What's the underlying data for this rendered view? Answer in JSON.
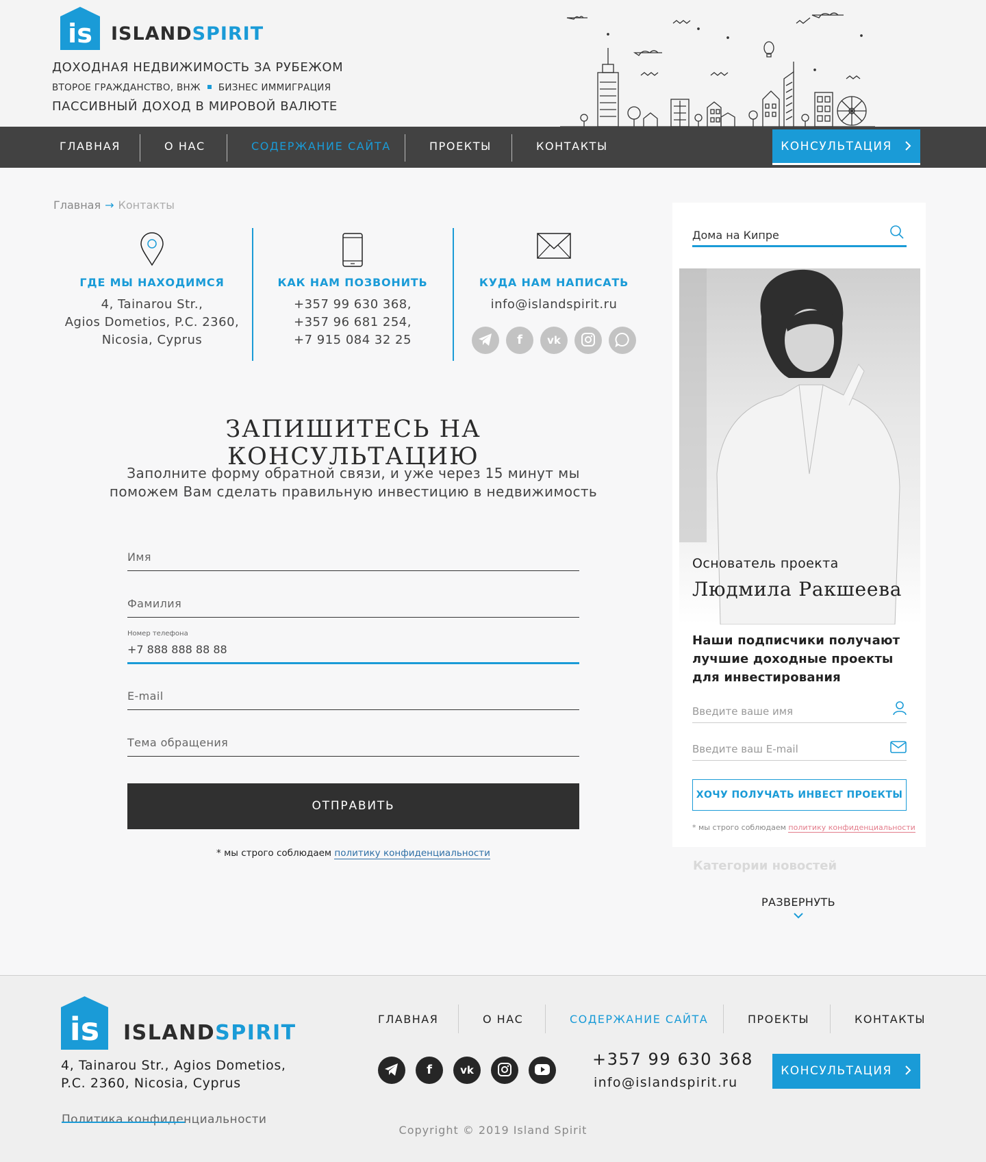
{
  "brand": {
    "logo_letters": "is",
    "name_part1": "ISLAND",
    "name_part2": "SPIRIT",
    "tagline1": "ДОХОДНАЯ НЕДВИЖИМОСТЬ ЗА РУБЕЖОМ",
    "tagline2_a": "ВТОРОЕ ГРАЖДАНСТВО, ВНЖ",
    "tagline2_b": "БИЗНЕС ИММИГРАЦИЯ",
    "tagline3": "ПАССИВНЫЙ ДОХОД В МИРОВОЙ ВАЛЮТЕ"
  },
  "nav": {
    "items": [
      "ГЛАВНАЯ",
      "О НАС",
      "СОДЕРЖАНИЕ САЙТА",
      "ПРОЕКТЫ",
      "КОНТАКТЫ"
    ],
    "active": "СОДЕРЖАНИЕ САЙТА",
    "cta": "КОНСУЛЬТАЦИЯ"
  },
  "breadcrumb": {
    "home": "Главная",
    "arrow": "→",
    "current": "Контакты"
  },
  "contacts": {
    "location": {
      "title": "ГДЕ МЫ НАХОДИМСЯ",
      "lines": [
        "4, Tainarou Str.,",
        "Agios Dometios, P.C. 2360,",
        "Nicosia, Cyprus"
      ]
    },
    "phone": {
      "title": "КАК НАМ ПОЗВОНИТЬ",
      "lines": [
        "+357 99 630 368,",
        "+357 96 681 254,",
        "+7 915 084 32 25"
      ]
    },
    "mail": {
      "title": "КУДА НАМ НАПИСАТЬ",
      "email": "info@islandspirit.ru"
    },
    "socials": [
      "telegram-icon",
      "facebook-icon",
      "vk-icon",
      "instagram-icon",
      "whatsapp-icon"
    ]
  },
  "form": {
    "title": "ЗАПИШИТЕСЬ НА КОНСУЛЬТАЦИЮ",
    "subtitle_line1": "Заполните форму обратной связи, и уже через 15 минут мы",
    "subtitle_line2": "поможем Вам сделать правильную инвестицию в недвижимость",
    "name_placeholder": "Имя",
    "surname_placeholder": "Фамилия",
    "phone_label": "Номер телефона",
    "phone_value": "+7 888 888 88 88",
    "email_placeholder": "E-mail",
    "topic_placeholder": "Тема обращения",
    "submit": "ОТПРАВИТЬ",
    "privacy_prefix": "* мы строго соблюдаем",
    "privacy_link": "политику конфиденциальности"
  },
  "sidebar": {
    "search_value": "Дома на Кипре",
    "founder_label": "Основатель проекта",
    "founder_name": "Людмила Ракшеева",
    "subscribe_text": "Наши подписчики получают лучшие доходные проекты для инвестирования",
    "name_placeholder": "Введите ваше имя",
    "email_placeholder": "Введите ваш E-mail",
    "button": "ХОЧУ ПОЛУЧАТЬ ИНВЕСТ ПРОЕКТЫ",
    "privacy_prefix": "* мы строго соблюдаем",
    "privacy_link": "политику конфиденциальности",
    "categories_title": "Категории новостей",
    "expand": "РАЗВЕРНУТЬ"
  },
  "footer": {
    "address_line1": "4, Tainarou Str., Agios Dometios,",
    "address_line2": "P.C. 2360, Nicosia, Cyprus",
    "policy": "Политика конфиденциальности",
    "nav": [
      "ГЛАВНАЯ",
      "О НАС",
      "СОДЕРЖАНИЕ САЙТА",
      "ПРОЕКТЫ",
      "КОНТАКТЫ"
    ],
    "socials": [
      "telegram-icon",
      "facebook-icon",
      "vk-icon",
      "instagram-icon",
      "youtube-icon"
    ],
    "phone": "+357 99 630 368",
    "email": "info@islandspirit.ru",
    "cta": "КОНСУЛЬТАЦИЯ",
    "copyright": "Copyright © 2019 Island Spirit"
  },
  "colors": {
    "accent": "#1a9bd7",
    "nav_bg": "#424242",
    "button_dark": "#303030"
  }
}
